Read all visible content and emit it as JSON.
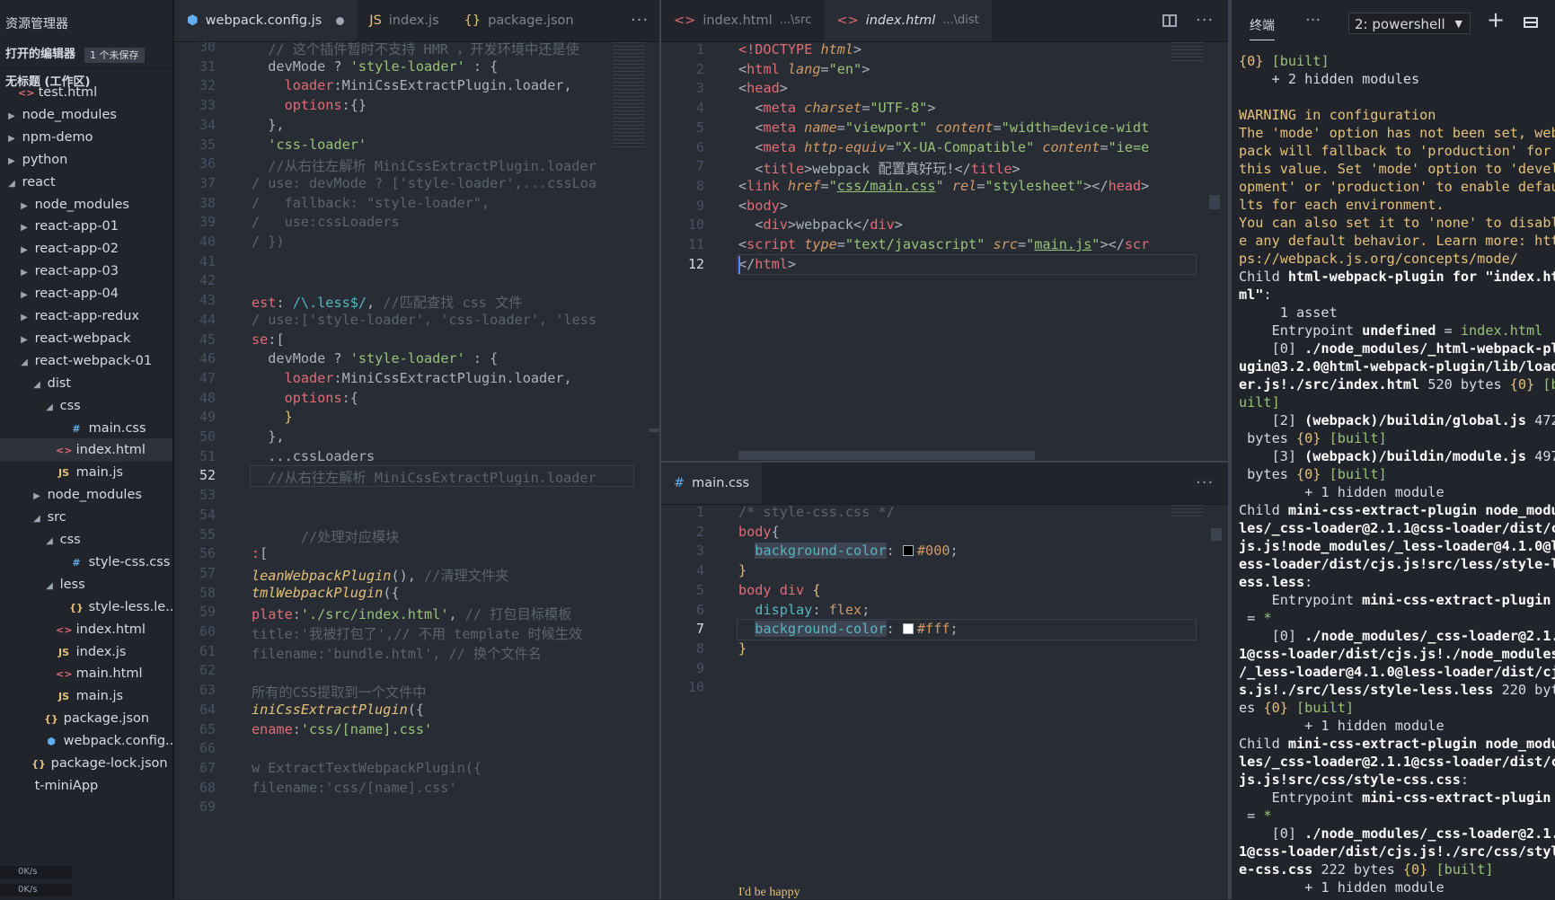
{
  "sidebar": {
    "title": "资源管理器",
    "open_editors": {
      "label": "打开的编辑器",
      "badge": "1 个未保存"
    },
    "workspace": "无标题 (工作区)",
    "tree": [
      {
        "label": "test.html",
        "icon": "html-icon",
        "depth": 1,
        "arrow": ""
      },
      {
        "label": "node_modules",
        "icon": "",
        "depth": 1,
        "arrow": "right"
      },
      {
        "label": "npm-demo",
        "icon": "",
        "depth": 1,
        "arrow": "right"
      },
      {
        "label": "python",
        "icon": "",
        "depth": 1,
        "arrow": "right"
      },
      {
        "label": "react",
        "icon": "",
        "depth": 1,
        "arrow": "down"
      },
      {
        "label": "node_modules",
        "icon": "",
        "depth": 2,
        "arrow": "right"
      },
      {
        "label": "react-app-01",
        "icon": "",
        "depth": 2,
        "arrow": "right"
      },
      {
        "label": "react-app-02",
        "icon": "",
        "depth": 2,
        "arrow": "right"
      },
      {
        "label": "react-app-03",
        "icon": "",
        "depth": 2,
        "arrow": "right"
      },
      {
        "label": "react-app-04",
        "icon": "",
        "depth": 2,
        "arrow": "right"
      },
      {
        "label": "react-app-redux",
        "icon": "",
        "depth": 2,
        "arrow": "right"
      },
      {
        "label": "react-webpack",
        "icon": "",
        "depth": 2,
        "arrow": "right"
      },
      {
        "label": "react-webpack-01",
        "icon": "",
        "depth": 2,
        "arrow": "down"
      },
      {
        "label": "dist",
        "icon": "",
        "depth": 3,
        "arrow": "down"
      },
      {
        "label": "css",
        "icon": "",
        "depth": 4,
        "arrow": "down"
      },
      {
        "label": "main.css",
        "icon": "css-icon",
        "depth": 5,
        "arrow": ""
      },
      {
        "label": "index.html",
        "icon": "html-icon",
        "depth": 4,
        "arrow": "",
        "selected": true
      },
      {
        "label": "main.js",
        "icon": "js-icon",
        "depth": 4,
        "arrow": ""
      },
      {
        "label": "node_modules",
        "icon": "",
        "depth": 3,
        "arrow": "right"
      },
      {
        "label": "src",
        "icon": "",
        "depth": 3,
        "arrow": "down"
      },
      {
        "label": "css",
        "icon": "",
        "depth": 4,
        "arrow": "down"
      },
      {
        "label": "style-css.css",
        "icon": "css-icon",
        "depth": 5,
        "arrow": ""
      },
      {
        "label": "less",
        "icon": "",
        "depth": 4,
        "arrow": "down"
      },
      {
        "label": "style-less.le...",
        "icon": "json-icon",
        "depth": 5,
        "arrow": ""
      },
      {
        "label": "index.html",
        "icon": "html-icon",
        "depth": 4,
        "arrow": ""
      },
      {
        "label": "index.js",
        "icon": "js-icon",
        "depth": 4,
        "arrow": ""
      },
      {
        "label": "main.html",
        "icon": "html-icon",
        "depth": 4,
        "arrow": ""
      },
      {
        "label": "main.js",
        "icon": "js-icon",
        "depth": 4,
        "arrow": ""
      },
      {
        "label": "package.json",
        "icon": "json-icon",
        "depth": 3,
        "arrow": ""
      },
      {
        "label": "webpack.config...",
        "icon": "webpack-icon",
        "depth": 3,
        "arrow": ""
      },
      {
        "label": "package-lock.json",
        "icon": "json-icon",
        "depth": 2,
        "arrow": ""
      },
      {
        "label": "t-miniApp",
        "icon": "",
        "depth": 2,
        "arrow": ""
      }
    ],
    "net_up": "0K/s",
    "net_down": "0K/s"
  },
  "group1": {
    "tabs": [
      {
        "label": "webpack.config.js",
        "icon": "webpack-icon",
        "active": true,
        "unsaved": true
      },
      {
        "label": "index.js",
        "icon": "js-icon"
      },
      {
        "label": "package.json",
        "icon": "json-icon"
      }
    ],
    "current_line": 52,
    "lines": [
      {
        "n": 30,
        "html": "<span class='c-cm'>  // 这个插件暂时不支持 HMR ，开发环境中还是使</span>"
      },
      {
        "n": 31,
        "html": "  devMode ? <span class='c-str'>'style-loader'</span> : {"
      },
      {
        "n": 32,
        "html": "    <span class='c-prop'>loader</span>:MiniCssExtractPlugin.loader,"
      },
      {
        "n": 33,
        "html": "    <span class='c-prop'>options</span>:{}"
      },
      {
        "n": 34,
        "html": "  },"
      },
      {
        "n": 35,
        "html": "  <span class='c-str'>'css-loader'</span>"
      },
      {
        "n": 36,
        "html": "<span class='c-cm'>  //从右往左解析 MiniCssExtractPlugin.loader</span>"
      },
      {
        "n": 37,
        "html": "<span class='c-cm'>/ use: devMode ? ['style-loader',...cssLoa</span>"
      },
      {
        "n": 38,
        "html": "<span class='c-cm'>/   fallback: \"style-loader\",</span>"
      },
      {
        "n": 39,
        "html": "<span class='c-cm'>/   use:cssLoaders</span>"
      },
      {
        "n": 40,
        "html": "<span class='c-cm'>/ })</span>"
      },
      {
        "n": 41,
        "html": ""
      },
      {
        "n": 42,
        "html": ""
      },
      {
        "n": 43,
        "html": "<span class='c-prop'>est</span>: <span class='c-val'>/\\.less$/</span>, <span class='c-cm'>//匹配查找 css 文件</span>"
      },
      {
        "n": 44,
        "html": "<span class='c-cm'>/ use:['style-loader', 'css-loader', 'less</span>"
      },
      {
        "n": 45,
        "html": "<span class='c-prop'>se</span>:["
      },
      {
        "n": 46,
        "html": "  devMode ? <span class='c-str'>'style-loader'</span> : {"
      },
      {
        "n": 47,
        "html": "    <span class='c-prop'>loader</span>:MiniCssExtractPlugin.loader,"
      },
      {
        "n": 48,
        "html": "    <span class='c-prop'>options</span>:{"
      },
      {
        "n": 49,
        "html": "    <span class='c-sel'>}</span>"
      },
      {
        "n": 50,
        "html": "  },"
      },
      {
        "n": 51,
        "html": "  ...cssLoaders"
      },
      {
        "n": 52,
        "html": "<span class='c-cm'>  //从右往左解析 MiniCssExtractPlugin.loader</span>"
      },
      {
        "n": 53,
        "html": ""
      },
      {
        "n": 54,
        "html": ""
      },
      {
        "n": 55,
        "html": "<span class='c-cm'>      //处理对应模块</span>"
      },
      {
        "n": 56,
        "html": "<span class='c-prop'>:</span>["
      },
      {
        "n": 57,
        "html": "<span class='c-it'>leanWebpackPlugin</span>(), <span class='c-cm'>//清理文件夹</span>"
      },
      {
        "n": 58,
        "html": "<span class='c-it'>tmlWebpackPlugin</span>({"
      },
      {
        "n": 59,
        "html": "<span class='c-prop'>plate</span>:<span class='c-str'>'./src/index.html'</span>, <span class='c-cm'>// 打包目标模板</span>"
      },
      {
        "n": 60,
        "html": "<span class='c-cm'>title:'我被打包了',// 不用 template 时候生效</span>"
      },
      {
        "n": 61,
        "html": "<span class='c-cm'>filename:'bundle.html', // 换个文件名</span>"
      },
      {
        "n": 62,
        "html": ""
      },
      {
        "n": 63,
        "html": "<span class='c-cm'>所有的CSS提取到一个文件中</span>"
      },
      {
        "n": 64,
        "html": "<span class='c-it'>iniCssExtractPlugin</span>({"
      },
      {
        "n": 65,
        "html": "<span class='c-prop'>ename</span>:<span class='c-str'>'css/[name].css'</span>"
      },
      {
        "n": 66,
        "html": ""
      },
      {
        "n": 67,
        "html": "<span class='c-cm'>w ExtractTextWebpackPlugin({</span>"
      },
      {
        "n": 68,
        "html": "<span class='c-cm'>filename:'css/[name].css'</span>"
      },
      {
        "n": 69,
        "html": ""
      }
    ]
  },
  "group2": {
    "tabs": [
      {
        "label": "index.html",
        "sub": "...\\src",
        "icon": "html-icon"
      },
      {
        "label": "index.html",
        "sub": "...\\dist",
        "icon": "html-icon",
        "active": true
      }
    ],
    "current_line": 12,
    "lines": [
      {
        "n": 1,
        "html": "<span class='c-tag'>&lt;!DOCTYPE</span> <span class='c-attr'>html</span>&gt;"
      },
      {
        "n": 2,
        "html": "&lt;<span class='c-tag'>html</span> <span class='c-attr'>lang</span>=<span class='c-str'>\"en\"</span>&gt;"
      },
      {
        "n": 3,
        "html": "&lt;<span class='c-tag'>head</span>&gt;"
      },
      {
        "n": 4,
        "html": "  &lt;<span class='c-tag'>meta</span> <span class='c-attr'>charset</span>=<span class='c-str'>\"UTF-8\"</span>&gt;"
      },
      {
        "n": 5,
        "html": "  &lt;<span class='c-tag'>meta</span> <span class='c-attr'>name</span>=<span class='c-str'>\"viewport\"</span> <span class='c-attr'>content</span>=<span class='c-str'>\"width=device-widt</span>"
      },
      {
        "n": 6,
        "html": "  &lt;<span class='c-tag'>meta</span> <span class='c-attr'>http-equiv</span>=<span class='c-str'>\"X-UA-Compatible\"</span> <span class='c-attr'>content</span>=<span class='c-str'>\"ie=e</span>"
      },
      {
        "n": 7,
        "html": "  &lt;<span class='c-tag'>title</span>&gt;webpack 配置真好玩!&lt;/<span class='c-tag'>title</span>&gt;"
      },
      {
        "n": 8,
        "html": "&lt;<span class='c-tag'>link</span> <span class='c-attr'>href</span>=<span class='c-str'>\"<u>css/main.css</u>\"</span> <span class='c-attr'>rel</span>=<span class='c-str'>\"stylesheet\"</span>&gt;&lt;/<span class='c-tag'>head</span>&gt;"
      },
      {
        "n": 9,
        "html": "&lt;<span class='c-tag'>body</span>&gt;"
      },
      {
        "n": 10,
        "html": "  &lt;<span class='c-tag'>div</span>&gt;webpack&lt;/<span class='c-tag'>div</span>&gt;"
      },
      {
        "n": 11,
        "html": "&lt;<span class='c-tag'>script</span> <span class='c-attr'>type</span>=<span class='c-str'>\"text/javascript\"</span> <span class='c-attr'>src</span>=<span class='c-str'>\"<u>main.js</u>\"</span>&gt;&lt;/<span class='c-tag'>scr</span>"
      },
      {
        "n": 12,
        "html": "&lt;/<span class='c-tag'>html</span>&gt;"
      }
    ]
  },
  "group3": {
    "tabs": [
      {
        "label": "main.css",
        "icon": "css-icon",
        "active": true
      }
    ],
    "current_line": 7,
    "lines": [
      {
        "n": 1,
        "html": "<span class='c-cm'>/* style-css.css */</span>"
      },
      {
        "n": 2,
        "html": "<span class='c-tag'>body</span>{"
      },
      {
        "n": 3,
        "html": "  <span class='hl c-val'>background-color</span>: <span class='sw' style='background:#000'></span><span class='c-num'>#000</span>;"
      },
      {
        "n": 4,
        "html": "<span class='c-sel'>}</span>"
      },
      {
        "n": 5,
        "html": "<span class='c-tag'>body</span> <span class='c-tag'>div</span> <span class='c-sel'>{</span>"
      },
      {
        "n": 6,
        "html": "  <span class='c-val'>display</span>: <span class='c-num'>flex</span>;"
      },
      {
        "n": 7,
        "html": "  <span class='hl c-val'>background-color</span>: <span class='sw' style='background:#fff'></span><span class='c-num'>#fff</span>;"
      },
      {
        "n": 8,
        "html": "<span class='c-sel'>}</span>"
      },
      {
        "n": 9,
        "html": ""
      },
      {
        "n": 10,
        "html": ""
      }
    ],
    "tooltip": "I'd be happy"
  },
  "terminal": {
    "tab_label": "终端",
    "shell_select": "2: powershell",
    "lines_html": [
      "<span class='t-y'>{0}</span> <span class='t-g'>[built]</span>",
      "    + 2 hidden modules",
      "",
      "<span class='t-y'>WARNING in configuration</span>",
      "<span class='t-y'>The 'mode' option has not been set, web</span>",
      "<span class='t-y'>pack will fallback to 'production' for</span>",
      "<span class='t-y'>this value. Set 'mode' option to 'devel</span>",
      "<span class='t-y'>opment' or 'production' to enable defau</span>",
      "<span class='t-y'>lts for each environment.</span>",
      "<span class='t-y'>You can also set it to 'none' to disabl</span>",
      "<span class='t-y'>e any default behavior. Learn more: htt</span>",
      "<span class='t-y'>ps://webpack.js.org/concepts/mode/</span>",
      "Child <span class='t-b'>html-webpack-plugin for \"index.ht</span>",
      "<span class='t-b'>ml\"</span>:",
      "     1 asset",
      "    Entrypoint <span class='t-b'>undefined</span> = <span class='t-g'>index.html</span>",
      "    [0] <span class='t-b'>./node_modules/_html-webpack-pl</span>",
      "<span class='t-b'>ugin@3.2.0@html-webpack-plugin/lib/load</span>",
      "<span class='t-b'>er.js!./src/index.html</span> 520 bytes <span class='t-y'>{0}</span> <span class='t-g'>[b</span>",
      "<span class='t-g'>uilt]</span>",
      "    [2] <span class='t-b'>(webpack)/buildin/global.js</span> 472",
      " bytes <span class='t-y'>{0}</span> <span class='t-g'>[built]</span>",
      "    [3] <span class='t-b'>(webpack)/buildin/module.js</span> 497",
      " bytes <span class='t-y'>{0}</span> <span class='t-g'>[built]</span>",
      "        + 1 hidden module",
      "Child <span class='t-b'>mini-css-extract-plugin node_modu</span>",
      "<span class='t-b'>les/_css-loader@2.1.1@css-loader/dist/c</span>",
      "<span class='t-b'>js.js!node_modules/_less-loader@4.1.0@l</span>",
      "<span class='t-b'>ess-loader/dist/cjs.js!src/less/style-l</span>",
      "<span class='t-b'>ess.less</span>:",
      "    Entrypoint <span class='t-b'>mini-css-extract-plugin</span>",
      " = <span class='t-g'>*</span>",
      "    [0] <span class='t-b'>./node_modules/_css-loader@2.1.</span>",
      "<span class='t-b'>1@css-loader/dist/cjs.js!./node_modules</span>",
      "<span class='t-b'>/_less-loader@4.1.0@less-loader/dist/cj</span>",
      "<span class='t-b'>s.js!./src/less/style-less.less</span> 220 byt",
      "es <span class='t-y'>{0}</span> <span class='t-g'>[built]</span>",
      "        + 1 hidden module",
      "Child <span class='t-b'>mini-css-extract-plugin node_modu</span>",
      "<span class='t-b'>les/_css-loader@2.1.1@css-loader/dist/c</span>",
      "<span class='t-b'>js.js!src/css/style-css.css</span>:",
      "    Entrypoint <span class='t-b'>mini-css-extract-plugin</span>",
      " = <span class='t-g'>*</span>",
      "    [0] <span class='t-b'>./node_modules/_css-loader@2.1.</span>",
      "<span class='t-b'>1@css-loader/dist/cjs.js!./src/css/styl</span>",
      "<span class='t-b'>e-css.css</span> 222 bytes <span class='t-y'>{0}</span> <span class='t-g'>[built]</span>",
      "        + 1 hidden module"
    ]
  }
}
